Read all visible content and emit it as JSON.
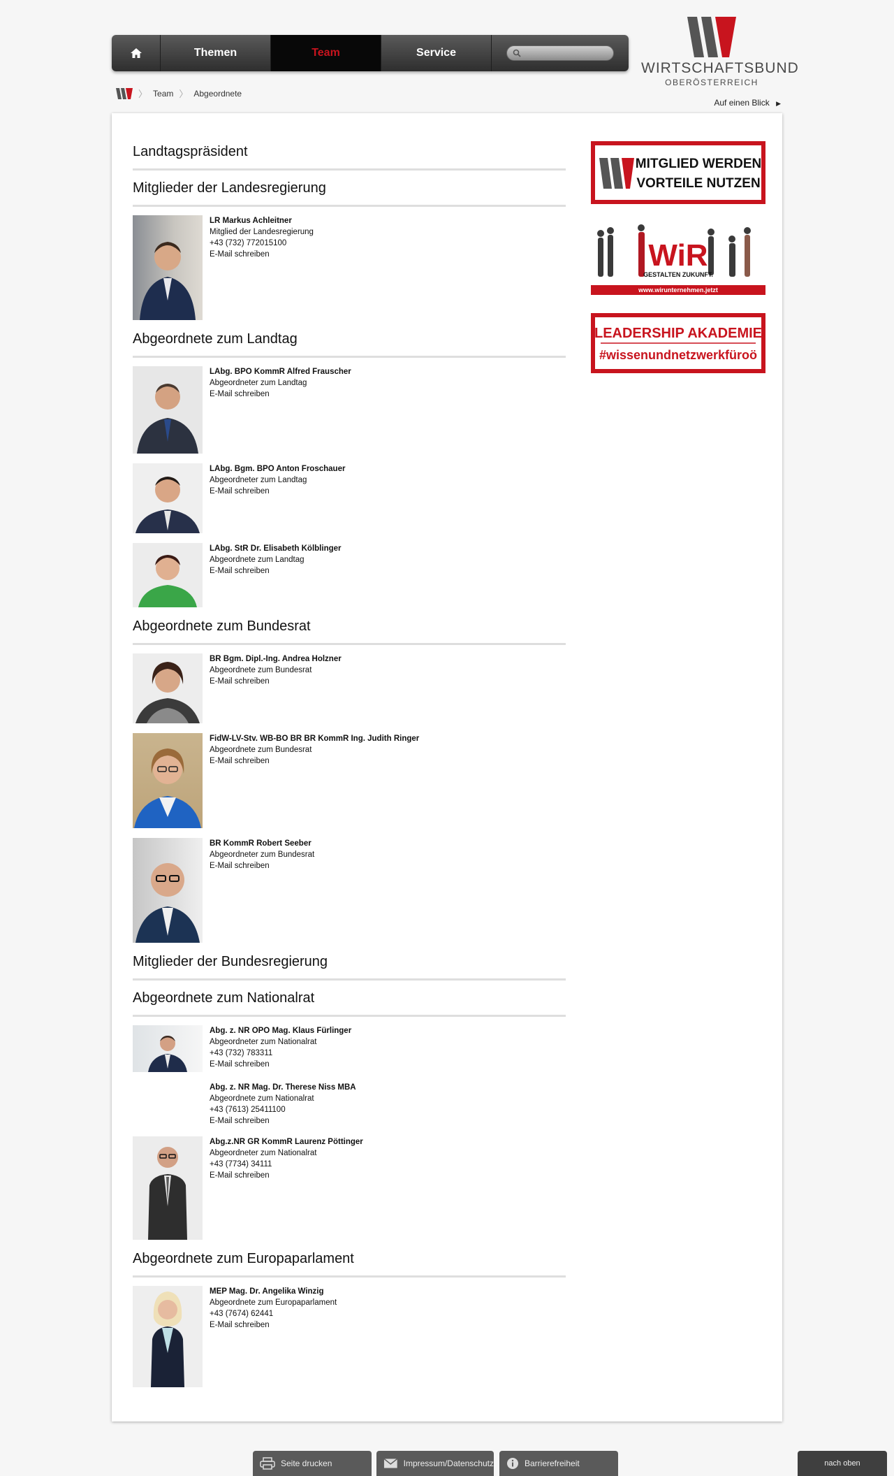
{
  "nav": {
    "home_icon": "home-icon",
    "items": [
      "Themen",
      "Team",
      "Service"
    ],
    "active_index": 1,
    "search_placeholder": ""
  },
  "logo": {
    "word": "WIRTSCHAFTSBUND",
    "sub": "OBERÖSTERREICH",
    "colors": {
      "dark": "#555555",
      "red": "#c8141e"
    }
  },
  "breadcrumb": [
    "Team",
    "Abgeordnete"
  ],
  "glance": "Auf einen Blick",
  "sections": [
    {
      "title": "Landtagspräsident",
      "people": []
    },
    {
      "title": "Mitglieder der Landesregierung",
      "people": [
        {
          "name": "LR Markus Achleitner",
          "role": "Mitglied der Landesregierung",
          "phone": "+43 (732) 772015100",
          "mail": "E-Mail schreiben"
        }
      ]
    },
    {
      "title": "Abgeordnete zum Landtag",
      "people": [
        {
          "name": "LAbg. BPO KommR Alfred Frauscher",
          "role": "Abgeordneter zum Landtag",
          "mail": "E-Mail schreiben"
        },
        {
          "name": "LAbg. Bgm. BPO Anton Froschauer",
          "role": "Abgeordneter zum Landtag",
          "mail": "E-Mail schreiben"
        },
        {
          "name": "LAbg. StR Dr. Elisabeth Kölblinger",
          "role": "Abgeordnete zum Landtag",
          "mail": "E-Mail schreiben"
        }
      ]
    },
    {
      "title": "Abgeordnete zum Bundesrat",
      "people": [
        {
          "name": "BR Bgm. Dipl.-Ing. Andrea Holzner",
          "role": "Abgeordnete zum Bundesrat",
          "mail": "E-Mail schreiben"
        },
        {
          "name": "FidW-LV-Stv. WB-BO BR BR KommR Ing. Judith Ringer",
          "role": "Abgeordnete zum Bundesrat",
          "mail": "E-Mail schreiben"
        },
        {
          "name": "BR KommR Robert Seeber",
          "role": "Abgeordneter zum Bundesrat",
          "mail": "E-Mail schreiben"
        }
      ]
    },
    {
      "title": "Mitglieder der Bundesregierung",
      "people": []
    },
    {
      "title": "Abgeordnete zum Nationalrat",
      "people": [
        {
          "name": "Abg. z. NR OPO Mag. Klaus Fürlinger",
          "role": "Abgeordneter zum Nationalrat",
          "phone": "+43 (732) 783311",
          "mail": "E-Mail schreiben"
        },
        {
          "name": "Abg. z. NR Mag. Dr. Therese Niss MBA",
          "role": "Abgeordnete zum Nationalrat",
          "phone": "+43 (7613) 25411100",
          "mail": "E-Mail schreiben"
        },
        {
          "name": "Abg.z.NR GR KommR Laurenz Pöttinger",
          "role": "Abgeordneter zum Nationalrat",
          "phone": "+43 (7734) 34111",
          "mail": "E-Mail schreiben"
        }
      ]
    },
    {
      "title": "Abgeordnete zum Europaparlament",
      "people": [
        {
          "name": "MEP Mag. Dr. Angelika Winzig",
          "role": "Abgeordnete zum Europaparlament",
          "phone": "+43 (7674) 62441",
          "mail": "E-Mail schreiben"
        }
      ]
    }
  ],
  "banners": {
    "mitglied": [
      "MITGLIED WERDEN",
      "VORTEILE NUTZEN"
    ],
    "wir": {
      "logo": "WiR",
      "tagline": "GESTALTEN ZUKUNFT.",
      "url": "www.wirunternehmen.jetzt"
    },
    "leadership": [
      "LEADERSHIP AKADEMIE",
      "#wissenundnetzwerkfüroö"
    ],
    "accent": "#c8141e"
  },
  "footer": {
    "print": "Seite drucken",
    "impressum": "Impressum/Datenschutz",
    "barriere": "Barrierefreiheit",
    "totop": "nach oben"
  }
}
